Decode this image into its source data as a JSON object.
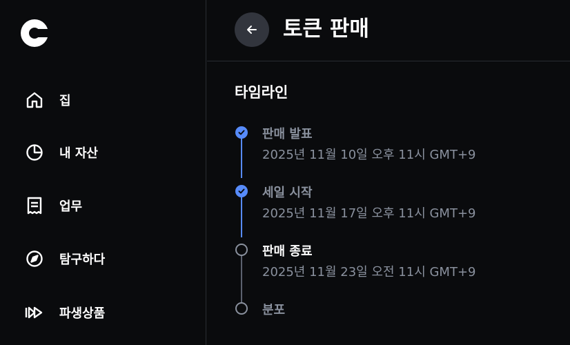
{
  "sidebar": {
    "logo": "coinbase-logo",
    "items": [
      {
        "label": "집",
        "icon": "home-icon"
      },
      {
        "label": "내 자산",
        "icon": "pie-chart-icon"
      },
      {
        "label": "업무",
        "icon": "receipt-icon"
      },
      {
        "label": "탐구하다",
        "icon": "compass-icon"
      },
      {
        "label": "파생상품",
        "icon": "fast-forward-icon"
      }
    ]
  },
  "header": {
    "back_icon": "arrow-left-icon",
    "title": "토큰 판매"
  },
  "timeline": {
    "title": "타임라인",
    "events": [
      {
        "title": "판매 발표",
        "date": "2025년 11월 10일 오후 11시 GMT+9",
        "status": "done"
      },
      {
        "title": "세일 시작",
        "date": "2025년 11월 17일 오후 11시 GMT+9",
        "status": "done"
      },
      {
        "title": "판매 종료",
        "date": "2025년 11월 23일 오전 11시 GMT+9",
        "status": "pending"
      },
      {
        "title": "분포",
        "date": "",
        "status": "pending"
      }
    ]
  },
  "colors": {
    "background": "#0a0b0d",
    "accent": "#578bfa",
    "muted_text": "#8a919e",
    "pending_line": "#5b616e",
    "divider": "#2a2d33"
  }
}
